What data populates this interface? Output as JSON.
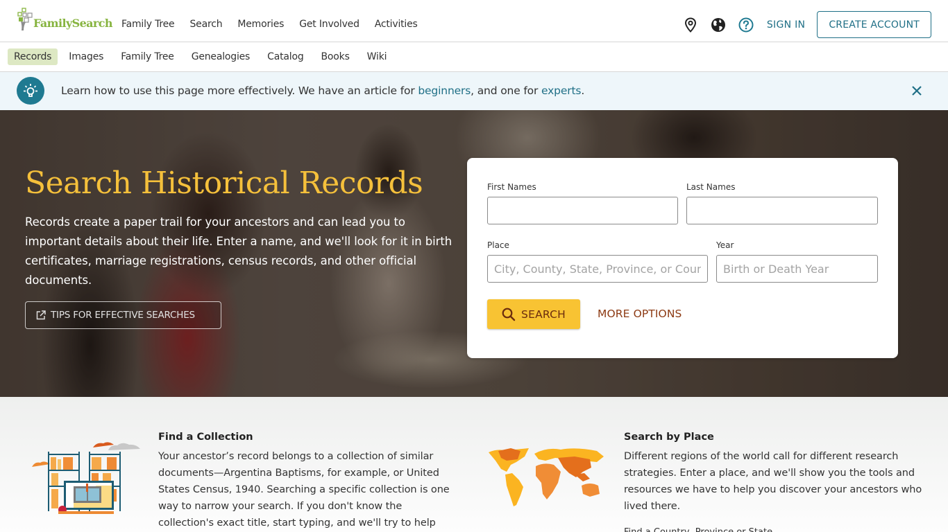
{
  "header": {
    "logo_text": "FamilySearch",
    "nav": [
      "Family Tree",
      "Search",
      "Memories",
      "Get Involved",
      "Activities"
    ],
    "icons": [
      "location-pin-icon",
      "globe-icon",
      "help-icon"
    ],
    "sign_in": "SIGN IN",
    "create_account": "CREATE ACCOUNT"
  },
  "subnav": {
    "items": [
      "Records",
      "Images",
      "Family Tree",
      "Genealogies",
      "Catalog",
      "Books",
      "Wiki"
    ],
    "active": "Records"
  },
  "banner": {
    "text_before": "Learn how to use this page more effectively. We have an article for ",
    "link1": "beginners",
    "text_middle": ", and one for ",
    "link2": "experts",
    "text_after": "."
  },
  "hero": {
    "title": "Search Historical Records",
    "description": "Records create a paper trail for your ancestors and can lead you to important details about their life. Enter a name, and we'll look for it in birth certificates, marriage registrations, census records, and other official documents.",
    "tips_button": "TIPS FOR EFFECTIVE SEARCHES"
  },
  "search_form": {
    "first_names_label": "First Names",
    "first_names_value": "",
    "last_names_label": "Last Names",
    "last_names_value": "",
    "place_label": "Place",
    "place_placeholder": "City, County, State, Province, or Country",
    "year_label": "Year",
    "year_placeholder": "Birth or Death Year",
    "search_button": "SEARCH",
    "more_options": "MORE OPTIONS"
  },
  "features": [
    {
      "title": "Find a Collection",
      "text": "Your ancestor’s record belongs to a collection of similar documents—Argentina Baptisms, for example, or United States Census, 1940. Searching a specific collection is one way to narrow your search. If you don't know the collection's exact title, start typing, and we'll try to help"
    },
    {
      "title": "Search by Place",
      "text": "Different regions of the world call for different research strategies. Enter a place, and we'll show you the tools and resources we have to help you discover your ancestors who lived there.",
      "cut_off_text": "Find a Country, Province or State"
    }
  ],
  "colors": {
    "brand_green": "#87b440",
    "link_teal": "#1f6f86",
    "hero_title": "#f5c03b",
    "search_button": "#f8c333",
    "more_options": "#8d3b14",
    "active_tab_bg": "#dde8c3"
  }
}
